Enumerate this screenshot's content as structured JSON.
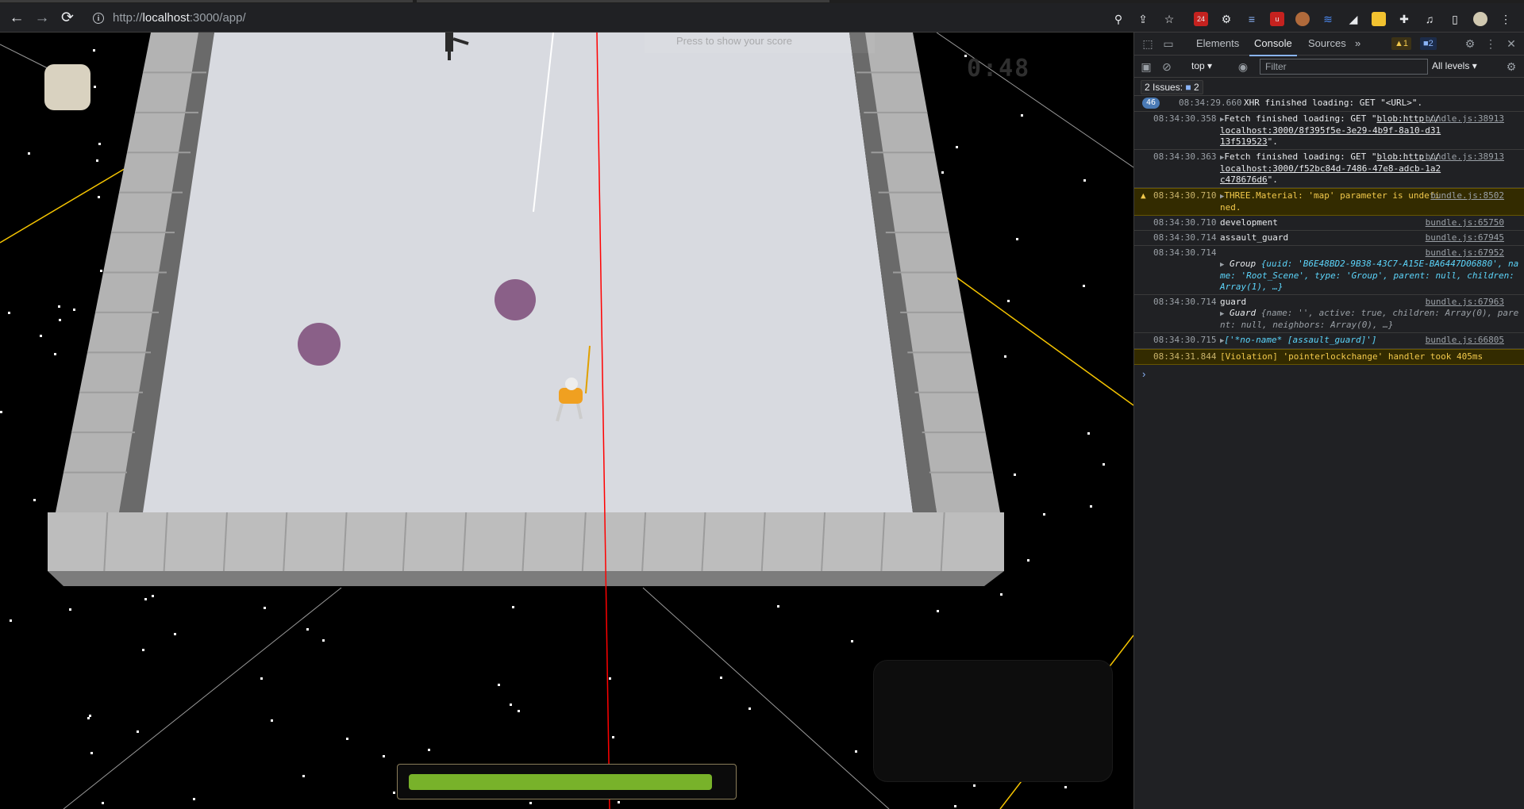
{
  "browser": {
    "url_scheme": "http://",
    "url_host": "localhost",
    "url_rest": ":3000/app/",
    "nav": {
      "back": "←",
      "forward": "→",
      "reload": "⟳"
    },
    "extensions_badge": "24"
  },
  "game": {
    "timer": "0:48",
    "hint_text": "Press   to show your score",
    "health_fraction": 0.96,
    "colors": {
      "floor": "#d8dae0",
      "wall": "#a9a9a9",
      "orb": "#8a6088",
      "health": "#78b22a",
      "laser": "#ff0000",
      "guideline": "#f5c400"
    }
  },
  "devtools": {
    "tabs": [
      "Elements",
      "Console",
      "Sources"
    ],
    "active_tab": "Console",
    "more": "»",
    "warn_count": "1",
    "msg_count": "2",
    "context": "top",
    "filter_placeholder": "Filter",
    "levels": "All levels",
    "issues_label": "2 Issues:",
    "issues_count": "2",
    "logs": [
      {
        "count": "46",
        "ts": "08:34:29.660",
        "msg": "XHR finished loading: GET \"<URL>\".",
        "src": ""
      },
      {
        "ts": "08:34:30.358",
        "msg_prefix": "Fetch finished loading: GET \"",
        "msg_link": "blob:http://localhost:3000/8f395f5e-3e29-4b9f-8a10-d3113f519523",
        "msg_suffix": "\".",
        "src": "bundle.js:38913"
      },
      {
        "ts": "08:34:30.363",
        "msg_prefix": "Fetch finished loading: GET \"",
        "msg_link": "blob:http://localhost:3000/f52bc84d-7486-47e8-adcb-1a2c478676d6",
        "msg_suffix": "\".",
        "src": "bundle.js:38913"
      },
      {
        "ts": "08:34:30.710",
        "msg": "THREE.Material: 'map' parameter is undefined.",
        "src": "bundle.js:8502",
        "level": "warn"
      },
      {
        "ts": "08:34:30.710",
        "msg": "development",
        "src": "bundle.js:65750"
      },
      {
        "ts": "08:34:30.714",
        "msg": "assault_guard",
        "src": "bundle.js:67945"
      },
      {
        "ts": "08:34:30.714",
        "src": "bundle.js:67952",
        "obj_head": "Group",
        "obj_body": "{uuid: 'B6E48BD2-9B38-43C7-A15E-BA6447D06880', name: 'Root_Scene', type: 'Group', parent: null, children: Array(1), …}"
      },
      {
        "ts": "08:34:30.714",
        "msg": "guard",
        "src": "bundle.js:67963",
        "obj_head": "Guard",
        "obj_body": "{name: '', active: true, children: Array(0), parent: null, neighbors: Array(0), …}"
      },
      {
        "ts": "08:34:30.715",
        "msg": "['*no-name* [assault_guard]']",
        "src": "bundle.js:66805"
      },
      {
        "ts": "08:34:31.844",
        "msg": "[Violation] 'pointerlockchange' handler took 405ms",
        "src": "",
        "level": "violation"
      }
    ],
    "prompt": "›"
  }
}
